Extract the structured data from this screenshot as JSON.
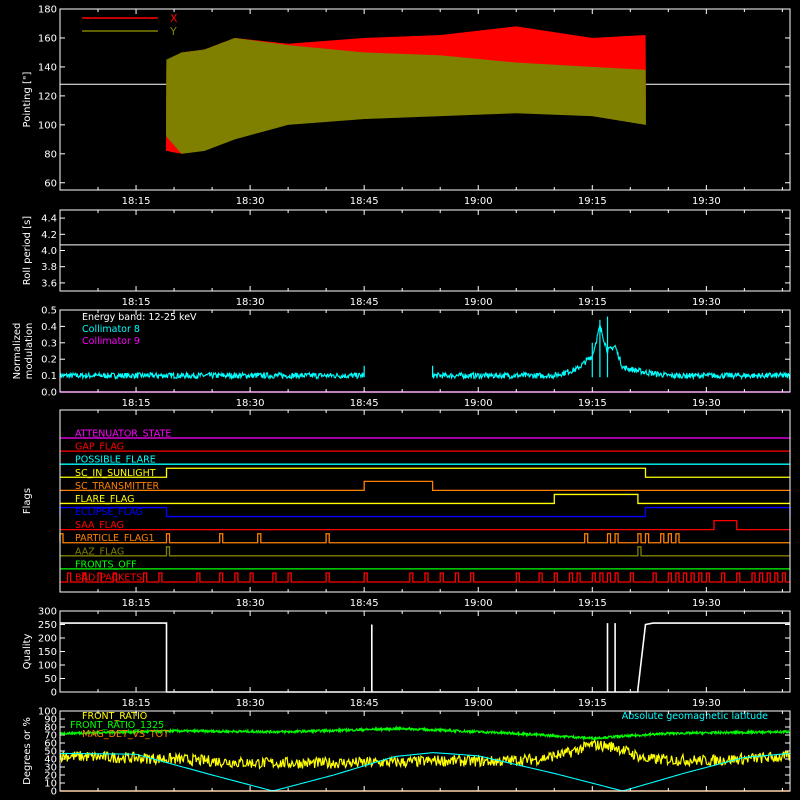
{
  "colors": {
    "background": "#000000",
    "frame": "#ffffff",
    "x_series": "#ff0000",
    "y_series": "#808000",
    "cyan": "#00ffff",
    "magenta": "#ff00ff",
    "red": "#ff0000",
    "orange": "#ff8000",
    "yellow": "#ffff00",
    "blue": "#0000ff",
    "olive": "#808000",
    "green": "#00ff00",
    "white": "#ffffff"
  },
  "time_axis": {
    "start": "18:05",
    "end": "19:41",
    "tick_labels": [
      "18:15",
      "18:30",
      "18:45",
      "19:00",
      "19:15",
      "19:30"
    ]
  },
  "chart_data": [
    {
      "id": "pointing",
      "type": "line",
      "ylabel": "Pointing [\"]",
      "ylim": [
        55,
        180
      ],
      "y_ticks": [
        60,
        80,
        100,
        120,
        140,
        160,
        180
      ],
      "baseline_value": 128,
      "legend_position": "top-left",
      "series": [
        {
          "name": "X",
          "color": "#ff0000",
          "profile": [
            [
              "18:19",
              82,
              138
            ],
            [
              "18:21",
              80,
              150
            ],
            [
              "18:24",
              92,
              152
            ],
            [
              "18:28",
              100,
              160
            ],
            [
              "18:35",
              103,
              156
            ],
            [
              "18:45",
              108,
              160
            ],
            [
              "18:55",
              112,
              162
            ],
            [
              "19:05",
              113,
              168
            ],
            [
              "19:15",
              113,
              160
            ],
            [
              "19:22",
              110,
              162
            ]
          ]
        },
        {
          "name": "Y",
          "color": "#808000",
          "profile": [
            [
              "18:19",
              92,
              145
            ],
            [
              "18:21",
              80,
              150
            ],
            [
              "18:24",
              82,
              152
            ],
            [
              "18:28",
              90,
              160
            ],
            [
              "18:35",
              100,
              155
            ],
            [
              "18:45",
              104,
              150
            ],
            [
              "18:55",
              106,
              148
            ],
            [
              "19:05",
              108,
              143
            ],
            [
              "19:15",
              106,
              140
            ],
            [
              "19:22",
              100,
              138
            ]
          ]
        }
      ]
    },
    {
      "id": "roll-period",
      "type": "line",
      "ylabel": "Roll period [s]",
      "ylim": [
        3.5,
        4.5
      ],
      "y_ticks": [
        3.6,
        3.8,
        4.0,
        4.2,
        4.4
      ],
      "series": [
        {
          "name": "",
          "values": [
            [
              "18:05",
              4.07
            ],
            [
              "19:41",
              4.07
            ]
          ]
        }
      ]
    },
    {
      "id": "modulation",
      "type": "line",
      "ylabel_lines": [
        "Normalized",
        "modulation"
      ],
      "ylim": [
        0,
        0.5
      ],
      "y_ticks": [
        0.0,
        0.1,
        0.2,
        0.3,
        0.4,
        0.5
      ],
      "legend_position": "top-left",
      "legend_title": "Energy band: 12-25 keV",
      "series": [
        {
          "name": "Collimator 8",
          "color": "#00ffff",
          "data_segments": [
            [
              [
                "18:05",
                0.1
              ],
              [
                "18:45",
                0.1
              ]
            ],
            [
              [
                "18:54",
                0.1
              ],
              [
                "19:10",
                0.1
              ],
              [
                "19:13",
                0.14
              ],
              [
                "19:15",
                0.22
              ],
              [
                "19:16",
                0.4
              ],
              [
                "19:17",
                0.25
              ],
              [
                "19:18",
                0.28
              ],
              [
                "19:19",
                0.15
              ],
              [
                "19:22",
                0.12
              ],
              [
                "19:25",
                0.1
              ],
              [
                "19:41",
                0.1
              ]
            ]
          ],
          "spikes": [
            [
              "18:45",
              0.16
            ],
            [
              "18:54",
              0.16
            ],
            [
              "19:16",
              0.44
            ],
            [
              "19:17",
              0.46
            ],
            [
              "19:15",
              0.3
            ]
          ]
        },
        {
          "name": "Collimator 9",
          "color": "#ff00ff",
          "data_segments": [
            [
              [
                "18:05",
                0.0
              ],
              [
                "19:41",
                0.0
              ]
            ]
          ]
        }
      ]
    },
    {
      "id": "flags",
      "type": "line",
      "ylabel": "Flags",
      "series": [
        {
          "name": "ATTENUATOR_STATE",
          "color": "#ff00ff",
          "on": []
        },
        {
          "name": "GAP_FLAG",
          "color": "#ff0000",
          "on": []
        },
        {
          "name": "POSSIBLE_FLARE",
          "color": "#00ffff",
          "on": []
        },
        {
          "name": "SC_IN_SUNLIGHT",
          "color": "#ffff00",
          "on": [
            [
              "18:19",
              "19:22"
            ]
          ]
        },
        {
          "name": "SC_TRANSMITTER",
          "color": "#ff8000",
          "on": [
            [
              "18:45",
              "18:54"
            ]
          ]
        },
        {
          "name": "FLARE_FLAG",
          "color": "#ffff00",
          "on": [
            [
              "19:10",
              "19:21"
            ]
          ]
        },
        {
          "name": "ECLIPSE_FLAG",
          "color": "#0000ff",
          "on": [
            [
              "18:05",
              "18:19"
            ],
            [
              "19:22",
              "19:41"
            ]
          ]
        },
        {
          "name": "SAA_FLAG",
          "color": "#ff0000",
          "on": [
            [
              "19:31",
              "19:34"
            ]
          ]
        },
        {
          "name": "PARTICLE_FLAG1",
          "color": "#ff8000",
          "pulses": [
            "18:05",
            "18:19",
            "18:26",
            "18:31",
            "18:40",
            "19:14",
            "19:17",
            "19:18",
            "19:21",
            "19:22",
            "19:24",
            "19:25",
            "19:26"
          ]
        },
        {
          "name": "AAZ_FLAG",
          "color": "#808000",
          "pulses": [
            "18:19",
            "19:21"
          ]
        },
        {
          "name": "FRONTS_OFF",
          "color": "#00ff00",
          "on": []
        },
        {
          "name": "BAD_PACKETS",
          "color": "#ff0000",
          "pulses": [
            "18:06",
            "18:08",
            "18:10",
            "18:12",
            "18:16",
            "18:18",
            "18:23",
            "18:26",
            "18:28",
            "18:30",
            "18:33",
            "18:35",
            "18:40",
            "18:45",
            "18:51",
            "18:53",
            "18:55",
            "18:57",
            "18:59",
            "19:05",
            "19:08",
            "19:10",
            "19:12",
            "19:13",
            "19:15",
            "19:16",
            "19:17",
            "19:18",
            "19:20",
            "19:23",
            "19:25",
            "19:26",
            "19:27",
            "19:28",
            "19:29",
            "19:30",
            "19:32",
            "19:34",
            "19:36",
            "19:37",
            "19:38",
            "19:39",
            "19:40"
          ]
        }
      ]
    },
    {
      "id": "quality",
      "type": "line",
      "ylabel": "Quality",
      "ylim": [
        0,
        300
      ],
      "y_ticks": [
        0,
        50,
        100,
        150,
        200,
        250,
        300
      ],
      "series": [
        {
          "name": "",
          "color": "#ffffff",
          "values": [
            [
              "18:05",
              255
            ],
            [
              "18:19",
              255
            ],
            [
              "18:19",
              0
            ],
            [
              "18:46",
              0
            ],
            [
              "18:46",
              250
            ],
            [
              "18:46",
              0
            ],
            [
              "19:17",
              0
            ],
            [
              "19:17",
              255
            ],
            [
              "19:17",
              0
            ],
            [
              "19:18",
              0
            ],
            [
              "19:18",
              255
            ],
            [
              "19:18",
              0
            ],
            [
              "19:21",
              0
            ],
            [
              "19:21",
              10
            ],
            [
              "19:22",
              250
            ],
            [
              "19:23",
              255
            ],
            [
              "19:41",
              255
            ]
          ]
        }
      ]
    },
    {
      "id": "misc",
      "type": "line",
      "ylabel": "Degrees or %",
      "ylim": [
        0,
        100
      ],
      "y_ticks": [
        0,
        10,
        20,
        30,
        40,
        50,
        60,
        70,
        80,
        90,
        100
      ],
      "series": [
        {
          "name": "FRONT_RATIO",
          "color": "#ffff00",
          "values": [
            [
              "18:05",
              44
            ],
            [
              "18:20",
              40
            ],
            [
              "18:30",
              35
            ],
            [
              "18:40",
              35
            ],
            [
              "18:50",
              36
            ],
            [
              "18:55",
              38
            ],
            [
              "19:02",
              37
            ],
            [
              "19:08",
              40
            ],
            [
              "19:12",
              48
            ],
            [
              "19:15",
              58
            ],
            [
              "19:18",
              55
            ],
            [
              "19:22",
              40
            ],
            [
              "19:30",
              38
            ],
            [
              "19:41",
              43
            ]
          ]
        },
        {
          "name": "FRONT_RATIO_1325",
          "color": "#00ff00",
          "values": [
            [
              "18:05",
              72
            ],
            [
              "18:20",
              75
            ],
            [
              "18:35",
              74
            ],
            [
              "18:50",
              78
            ],
            [
              "19:05",
              72
            ],
            [
              "19:15",
              66
            ],
            [
              "19:25",
              72
            ],
            [
              "19:41",
              74
            ]
          ]
        },
        {
          "name": "MAG_DET_VS_TOT",
          "color": "#ff8000",
          "values": [
            [
              "18:05",
              0
            ],
            [
              "19:41",
              0
            ]
          ]
        },
        {
          "name": "Absolute geomagnetic latitude",
          "color": "#00ffff",
          "values": [
            [
              "18:05",
              47
            ],
            [
              "18:15",
              46
            ],
            [
              "18:25",
              20
            ],
            [
              "18:33",
              0
            ],
            [
              "18:41",
              20
            ],
            [
              "18:49",
              43
            ],
            [
              "18:54",
              48
            ],
            [
              "19:00",
              44
            ],
            [
              "19:10",
              22
            ],
            [
              "19:19",
              0
            ],
            [
              "19:27",
              22
            ],
            [
              "19:35",
              42
            ],
            [
              "19:41",
              47
            ]
          ]
        }
      ]
    }
  ]
}
